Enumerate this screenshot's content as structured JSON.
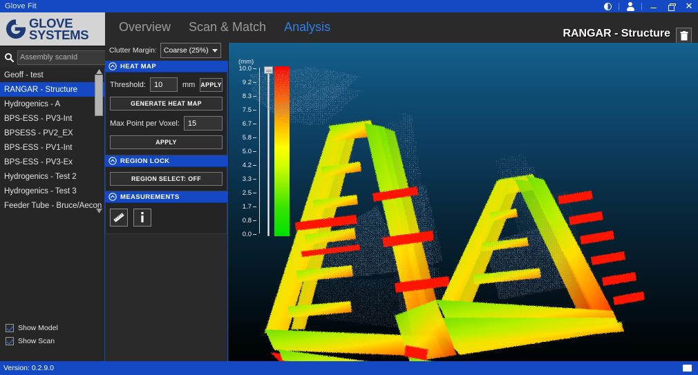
{
  "window": {
    "title": "Glove Fit",
    "controls": {
      "contrast": "contrast-toggle",
      "account": "user-account",
      "minimize": "minimize",
      "restore": "restore",
      "close": "close"
    }
  },
  "brand": {
    "line1": "GLOVE",
    "line2": "SYSTEMS"
  },
  "search": {
    "placeholder": "Assembly scanId",
    "value": "",
    "clear_label": "✕",
    "add_label": "+"
  },
  "sidebar": {
    "items": [
      {
        "label": "Geoff - test",
        "selected": false
      },
      {
        "label": "RANGAR - Structure",
        "selected": true
      },
      {
        "label": "Hydrogenics - A",
        "selected": false
      },
      {
        "label": "BPS-ESS - PV3-Int",
        "selected": false
      },
      {
        "label": "BPSESS - PV2_EX",
        "selected": false
      },
      {
        "label": "BPS-ESS - PV1-Int",
        "selected": false
      },
      {
        "label": "BPS-ESS - PV3-Ex",
        "selected": false
      },
      {
        "label": "Hydrogenics - Test 2",
        "selected": false
      },
      {
        "label": "Hydrogenics - Test 3",
        "selected": false
      },
      {
        "label": "Feeder Tube - Bruce/Aecon",
        "selected": false
      }
    ]
  },
  "nav": {
    "tabs": [
      {
        "label": "Overview",
        "active": false
      },
      {
        "label": "Scan & Match",
        "active": false
      },
      {
        "label": "Analysis",
        "active": true
      }
    ]
  },
  "header": {
    "document_title": "RANGAR - Structure",
    "delete_label": "delete"
  },
  "clutter": {
    "label": "Clutter Margin:",
    "value": "Coarse (25%)",
    "options": [
      "Coarse (25%)"
    ]
  },
  "heatmap_panel": {
    "title": "HEAT MAP",
    "threshold_label": "Threshold:",
    "threshold_value": "10",
    "threshold_unit": "mm",
    "threshold_apply": "APPLY",
    "generate_label": "GENERATE HEAT MAP",
    "voxel_label": "Max Point per Voxel:",
    "voxel_value": "15",
    "voxel_apply": "APPLY"
  },
  "region_panel": {
    "title": "REGION LOCK",
    "region_select_label": "REGION SELECT: OFF"
  },
  "measurements_panel": {
    "title": "MEASUREMENTS",
    "ruler_tool": "ruler",
    "info_tool": "info"
  },
  "display_options": [
    {
      "label": "Show Model",
      "checked": true
    },
    {
      "label": "Show Scan",
      "checked": true
    }
  ],
  "viewport": {
    "scale_unit": "(mm)",
    "scale_ticks": [
      "10.0",
      "9.2",
      "8.3",
      "7.5",
      "6.7",
      "5.8",
      "5.0",
      "4.2",
      "3.3",
      "2.5",
      "1.7",
      "0.8",
      "0.0"
    ],
    "scale_min": "0.0",
    "scale_max": "10.0",
    "colors": {
      "max": "#ff0000",
      "mid": "#ffff00",
      "min": "#00e000",
      "model_points": "#7f93b5"
    }
  },
  "statusbar": {
    "version": "Version: 0.2.9.0"
  },
  "theme": {
    "accent": "#1549c4",
    "panel_bg": "#2a2a2a",
    "tab_active": "#2f7fe8"
  }
}
